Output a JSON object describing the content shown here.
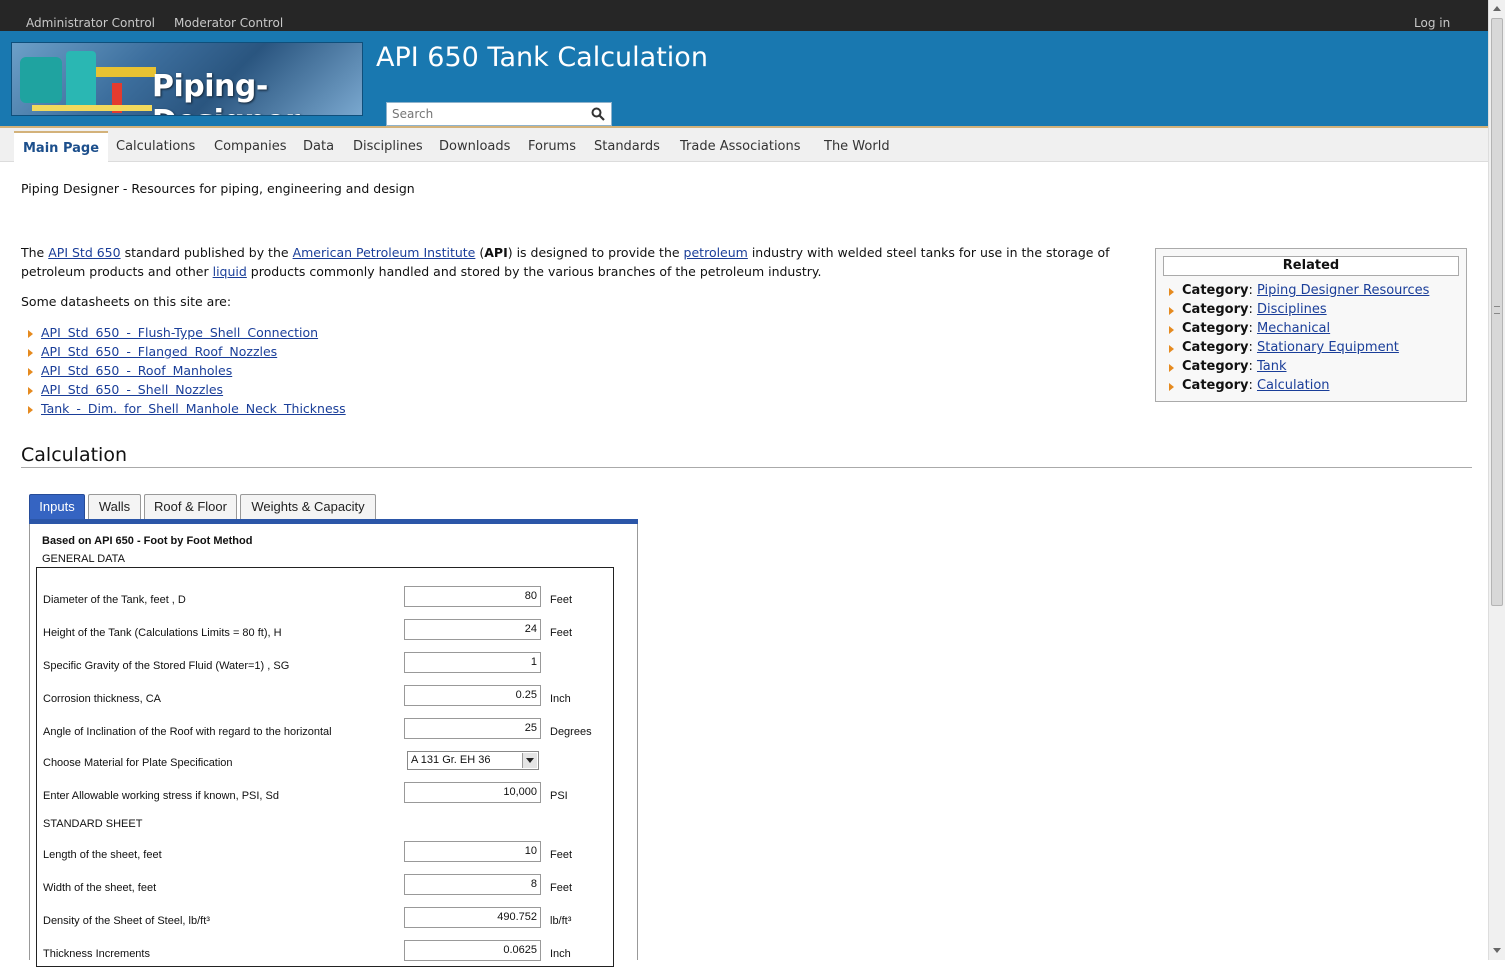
{
  "topbar": {
    "admin": "Administrator Control",
    "moderator": "Moderator Control",
    "login": "Log in"
  },
  "header": {
    "logo_text": "Piping-Designer",
    "site_title": "API 650 Tank Calculation",
    "search_placeholder": "Search"
  },
  "nav": [
    "Main Page",
    "Calculations",
    "Companies",
    "Data",
    "Disciplines",
    "Downloads",
    "Forums",
    "Standards",
    "Trade Associations",
    "The World"
  ],
  "tagline": "Piping Designer - Resources for piping, engineering and design",
  "intro": {
    "t1": "The ",
    "link1": "API Std 650",
    "t2": " standard published by the ",
    "link2": "American Petroleum Institute",
    "t3": " (",
    "bold": "API",
    "t4": ") is designed to provide the ",
    "link3": "petroleum",
    "t5": " industry with welded steel tanks for use in the storage of petroleum products and other ",
    "link4": "liquid",
    "t6": " products commonly handled and stored by the various branches of the petroleum industry."
  },
  "datasheets_intro": "Some datasheets on this site are:",
  "datasheets": [
    "API Std 650 - Flush-Type Shell Connection",
    "API Std 650 - Flanged Roof Nozzles",
    "API Std 650 - Roof Manholes",
    "API Std 650 - Shell Nozzles",
    "Tank - Dim. for Shell Manhole Neck Thickness"
  ],
  "related": {
    "title": "Related",
    "prefix": "Category",
    "items": [
      "Piping Designer Resources",
      "Disciplines",
      "Mechanical",
      "Stationary Equipment",
      "Tank",
      "Calculation"
    ]
  },
  "calc_heading": "Calculation",
  "tabs": [
    "Inputs",
    "Walls",
    "Roof & Floor",
    "Weights & Capacity"
  ],
  "panel": {
    "title": "Based on API 650 - Foot by Foot Method",
    "general": "GENERAL DATA",
    "standard": "STANDARD SHEET",
    "rows": [
      {
        "label": "Diameter of the Tank, feet , D",
        "value": "80",
        "unit": "Feet"
      },
      {
        "label": "Height of the Tank (Calculations Limits = 80 ft), H",
        "value": "24",
        "unit": "Feet"
      },
      {
        "label": "Specific Gravity of the Stored Fluid (Water=1) , SG",
        "value": "1",
        "unit": ""
      },
      {
        "label": "Corrosion thickness, CA",
        "value": "0.25",
        "unit": "Inch"
      },
      {
        "label": "Angle of Inclination of the Roof with regard to the horizontal",
        "value": "25",
        "unit": "Degrees"
      },
      {
        "label": "Choose Material for Plate Specification",
        "value": "A 131 Gr. EH 36",
        "unit": ""
      },
      {
        "label": "Enter Allowable working stress if known, PSI, Sd",
        "value": "10,000",
        "unit": "PSI"
      }
    ],
    "rows2": [
      {
        "label": "Length of the sheet, feet",
        "value": "10",
        "unit": "Feet"
      },
      {
        "label": "Width of the sheet, feet",
        "value": "8",
        "unit": "Feet"
      },
      {
        "label": "Density of the Sheet of Steel, lb/ft³",
        "value": "490.752",
        "unit": "lb/ft³"
      },
      {
        "label": "Thickness Increments",
        "value": "0.0625",
        "unit": "Inch"
      }
    ]
  },
  "colors": {
    "header_blue": "#1978b0",
    "topbar": "#262626",
    "tab_active": "#3564c2",
    "link": "#1a3e99",
    "bullet": "#e58a1f"
  }
}
